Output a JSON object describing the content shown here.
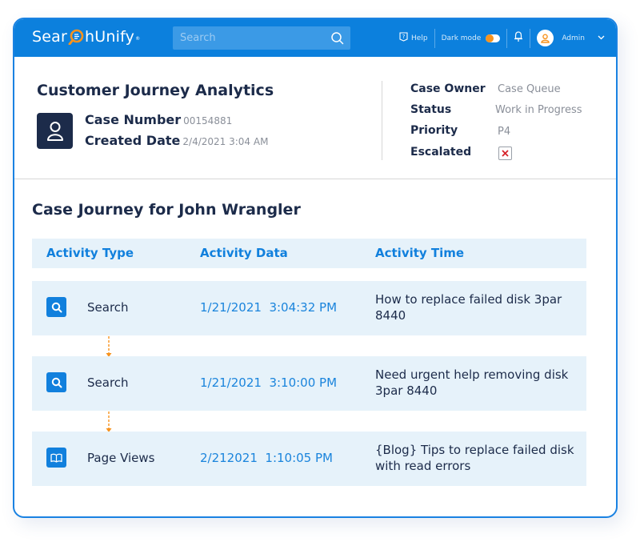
{
  "topbar": {
    "logo_text_before": "Sear",
    "logo_text_after": "hUnify",
    "logo_trademark": "®",
    "search_placeholder": "Search",
    "help_label": "Help",
    "dark_mode_label": "Dark mode",
    "dark_mode_on": false,
    "user_label": "Admin",
    "brand_color": "#0c80dd",
    "accent_color": "#f7931e"
  },
  "case": {
    "page_title": "Customer Journey Analytics",
    "case_number_label": "Case Number",
    "case_number_value": "00154881",
    "created_date_label": "Created Date",
    "created_date_value": "2/4/2021 3:04 AM",
    "case_owner_label": "Case Owner",
    "case_owner_value": "Case Queue",
    "status_label": "Status",
    "status_value": "Work in Progress",
    "priority_label": "Priority",
    "priority_value": "P4",
    "escalated_label": "Escalated",
    "escalated_value": false
  },
  "journey": {
    "title": "Case Journey for John Wrangler",
    "columns": [
      "Activity Type",
      "Activity Data",
      "Activity Time"
    ],
    "rows": [
      {
        "icon": "search-icon",
        "type": "Search",
        "data": "1/21/2021  3:04:32 PM",
        "time": "How to replace failed disk 3par 8440"
      },
      {
        "icon": "search-icon",
        "type": "Search",
        "data": "1/21/2021  3:10:00 PM",
        "time": "Need urgent help removing disk 3par 8440"
      },
      {
        "icon": "book-icon",
        "type": "Page Views",
        "data": "2/212021  1:10:05 PM",
        "time": "{Blog} Tips to replace failed disk with read errors"
      }
    ]
  }
}
